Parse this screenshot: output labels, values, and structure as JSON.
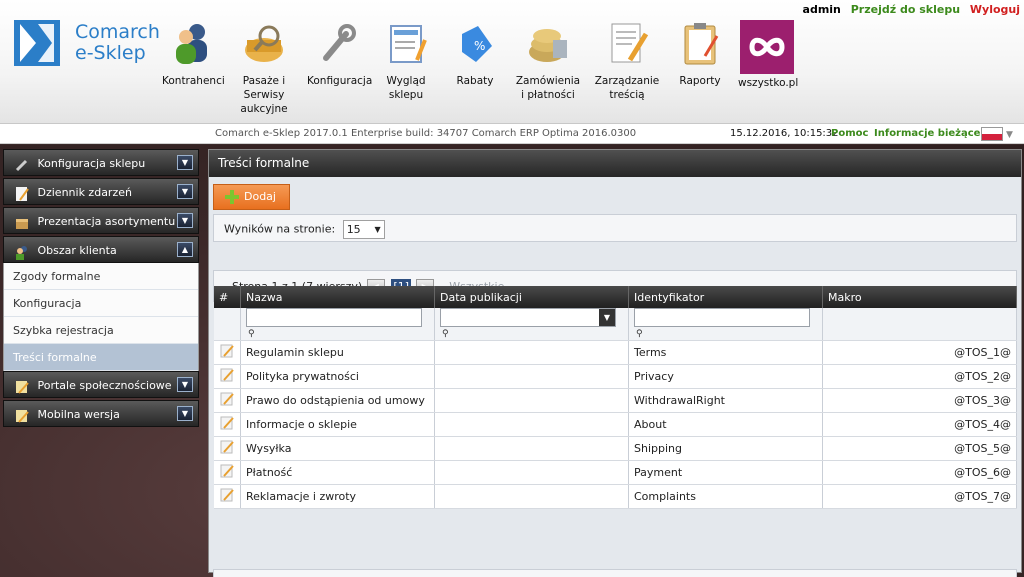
{
  "brand": {
    "line1": "Comarch",
    "line2": "e-Sklep"
  },
  "top_links": {
    "user": "admin",
    "go_to_shop": "Przejdź do sklepu",
    "logout": "Wyloguj"
  },
  "nav": [
    {
      "label": "Kontrahenci",
      "icon": "contractors-icon"
    },
    {
      "label": "Pasaże i Serwisy aukcyjne",
      "icon": "auction-basket-icon"
    },
    {
      "label": "Konfiguracja",
      "icon": "wrench-icon"
    },
    {
      "label": "Wygląd sklepu",
      "icon": "layout-icon"
    },
    {
      "label": "Rabaty",
      "icon": "discount-tag-icon"
    },
    {
      "label": "Zamówienia i płatności",
      "icon": "orders-icon"
    },
    {
      "label": "Zarządzanie treścią",
      "icon": "content-edit-icon"
    },
    {
      "label": "Raporty",
      "icon": "clipboard-icon"
    },
    {
      "label": "wszystko.pl",
      "icon": "infinity-icon"
    }
  ],
  "status": {
    "build": "Comarch e-Sklep 2017.0.1 Enterprise build: 34707 Comarch ERP Optima 2016.0300",
    "datetime": "15.12.2016, 10:15:32",
    "help": "Pomoc",
    "info": "Informacje bieżące"
  },
  "sidebar": {
    "groups_top": [
      {
        "label": "Konfiguracja sklepu",
        "icon": "wrench-icon"
      },
      {
        "label": "Dziennik zdarzeń",
        "icon": "journal-icon"
      },
      {
        "label": "Prezentacja asortymentu",
        "icon": "box-icon"
      },
      {
        "label": "Obszar klienta",
        "icon": "users-icon"
      }
    ],
    "sub_items": [
      "Zgody formalne",
      "Konfiguracja",
      "Szybka rejestracja",
      "Treści formalne"
    ],
    "groups_bottom": [
      {
        "label": "Portale społecznościowe",
        "icon": "social-icon"
      },
      {
        "label": "Mobilna wersja",
        "icon": "mobile-icon"
      }
    ]
  },
  "main": {
    "title": "Treści formalne",
    "add_label": "Dodaj",
    "per_page_label": "Wyników na stronie:",
    "per_page_value": "15",
    "pager": {
      "info": "Strona 1 z 1 (7 wierszy)",
      "current": "[1]",
      "all": "Wszystkie"
    },
    "columns": [
      "#",
      "Nazwa",
      "Data publikacji",
      "Identyfikator",
      "Makro"
    ],
    "rows": [
      {
        "name": "Regulamin sklepu",
        "date": "",
        "id": "Terms",
        "macro": "@TOS_1@"
      },
      {
        "name": "Polityka prywatności",
        "date": "",
        "id": "Privacy",
        "macro": "@TOS_2@"
      },
      {
        "name": "Prawo do odstąpienia od umowy",
        "date": "",
        "id": "WithdrawalRight",
        "macro": "@TOS_3@"
      },
      {
        "name": "Informacje o sklepie",
        "date": "",
        "id": "About",
        "macro": "@TOS_4@"
      },
      {
        "name": "Wysyłka",
        "date": "",
        "id": "Shipping",
        "macro": "@TOS_5@"
      },
      {
        "name": "Płatność",
        "date": "",
        "id": "Payment",
        "macro": "@TOS_6@"
      },
      {
        "name": "Reklamacje i zwroty",
        "date": "",
        "id": "Complaints",
        "macro": "@TOS_7@"
      }
    ]
  },
  "colors": {
    "accent": "#2b7ec8",
    "link_green": "#3c8a1c",
    "logout_red": "#d12020",
    "add_orange": "#e8701f",
    "wszystko_magenta": "#9c1f6e"
  }
}
